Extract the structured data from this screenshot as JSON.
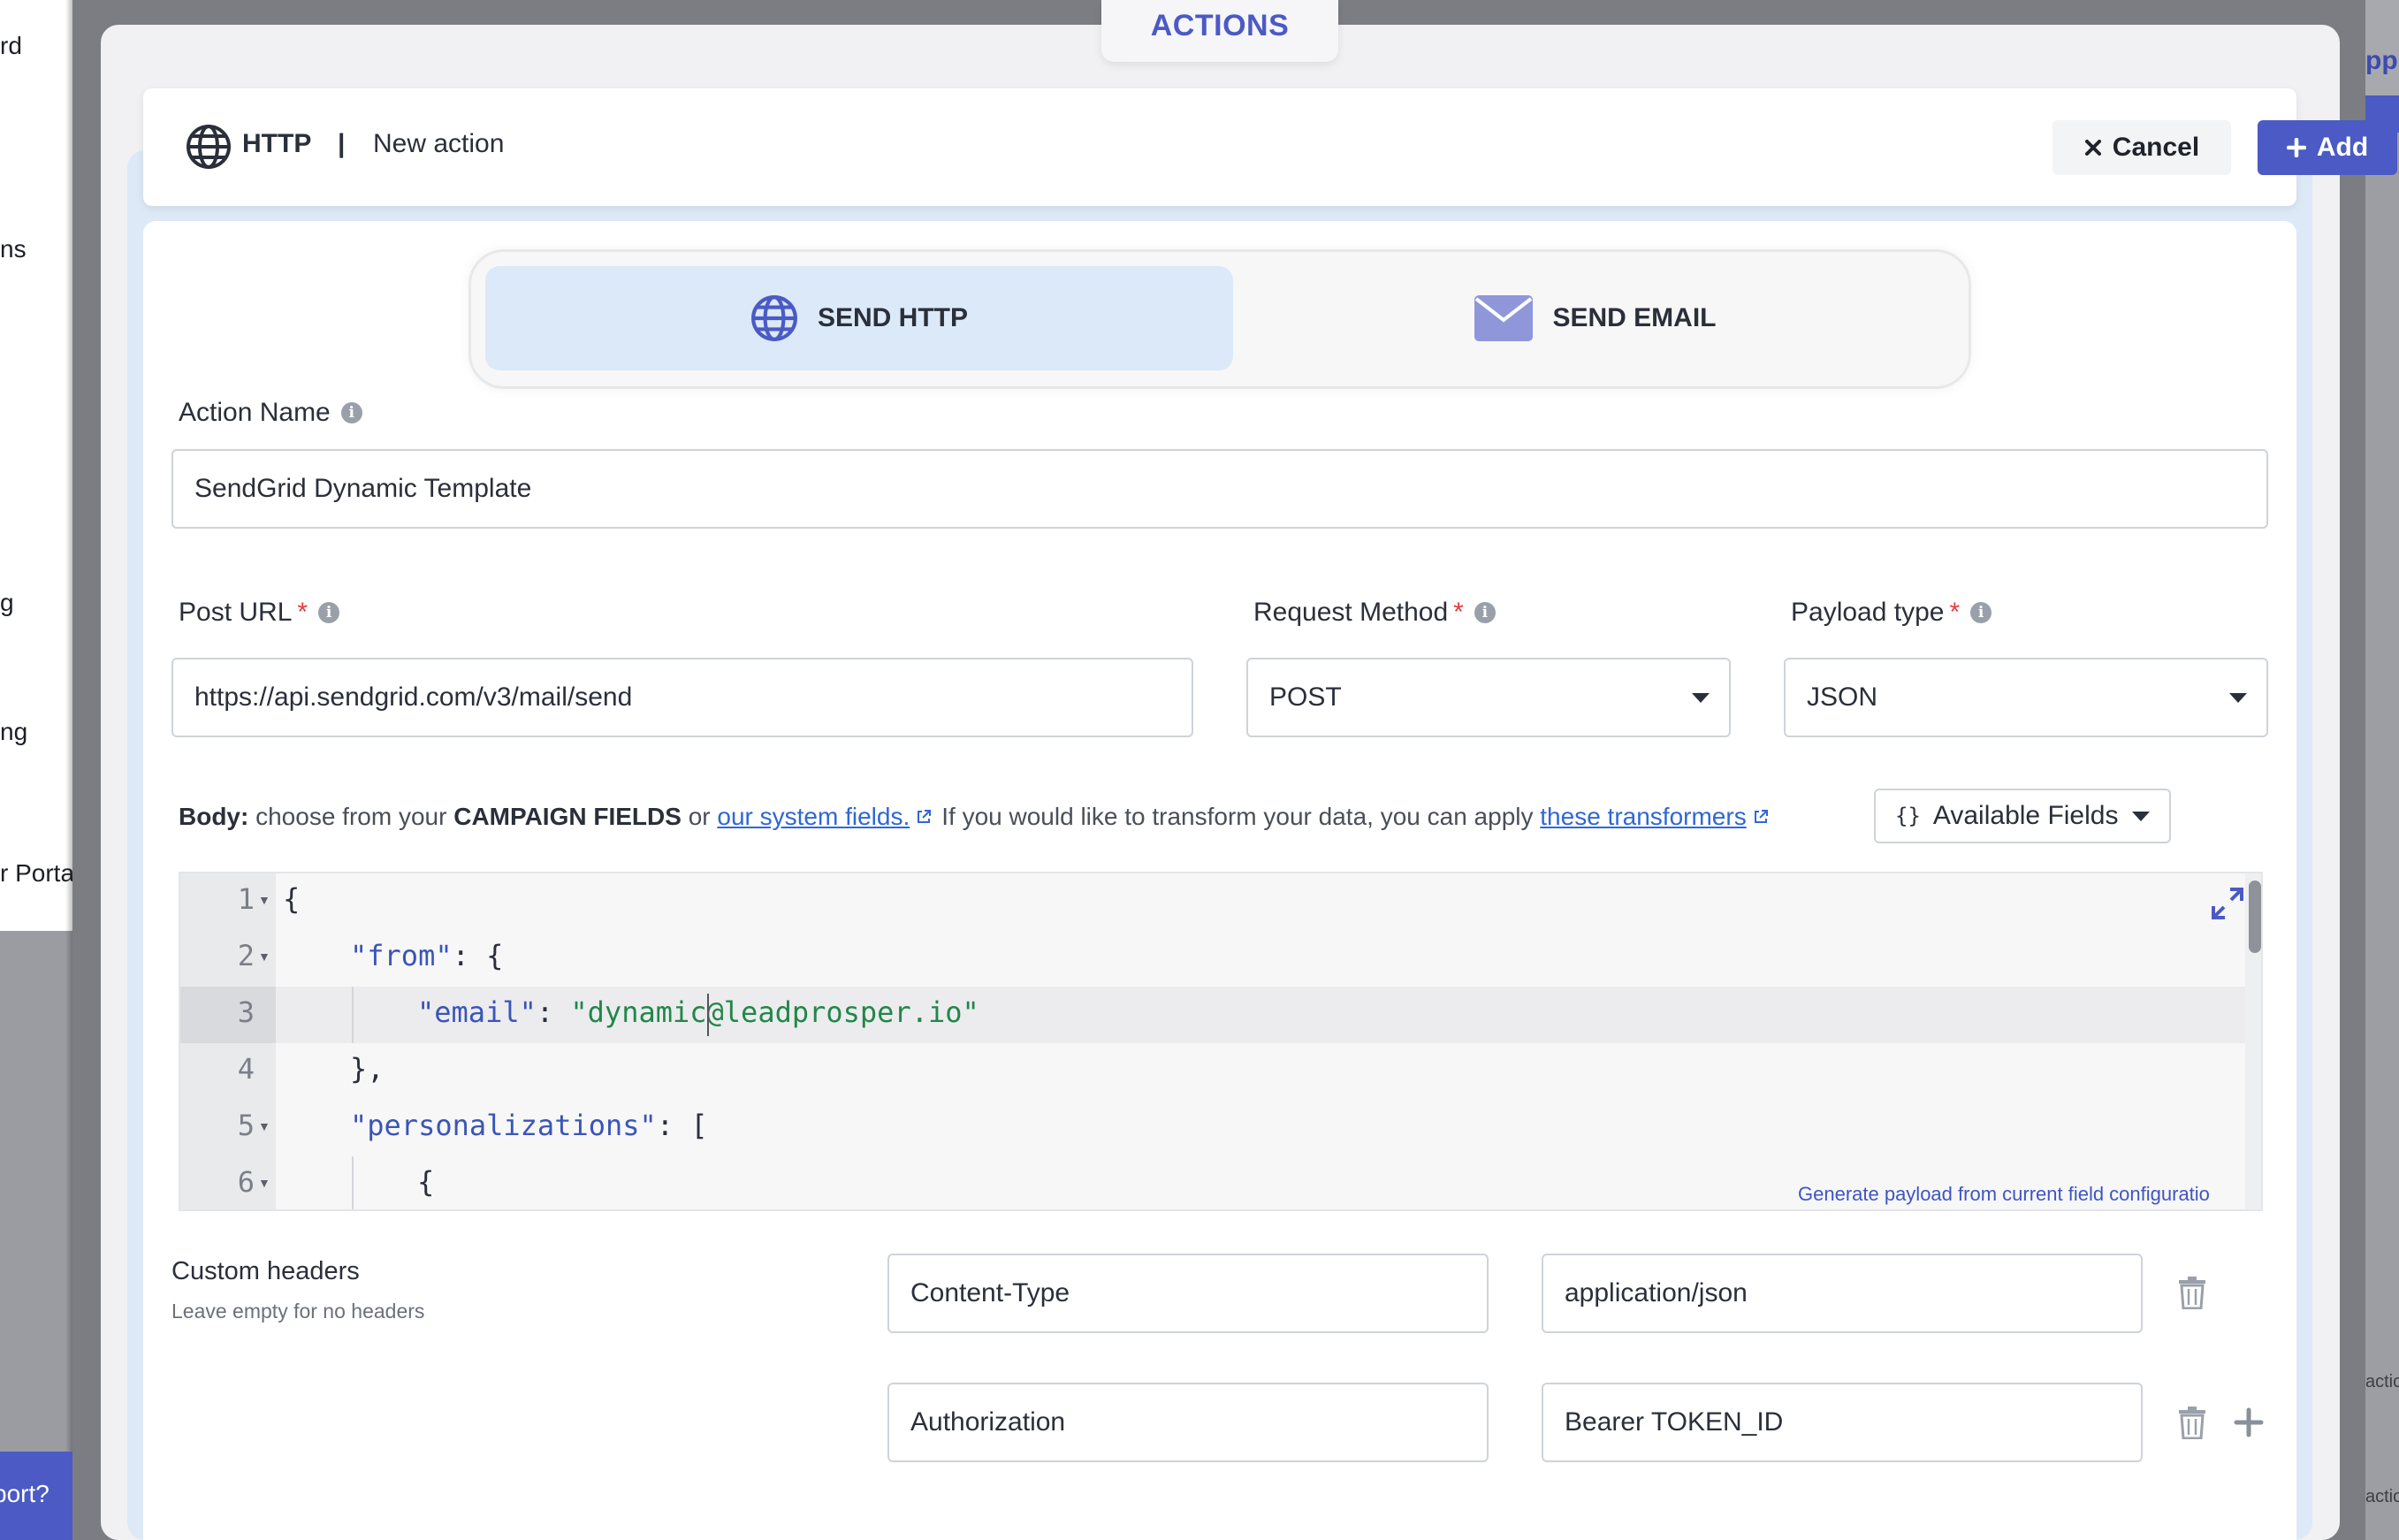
{
  "background": {
    "left_labels": [
      "rd",
      "ns",
      "g",
      "ng",
      "r Porta"
    ],
    "support_label": "port?",
    "right_labels": [
      "pp",
      "actio",
      "actio"
    ]
  },
  "modal": {
    "section_title": "ACTIONS",
    "header": {
      "icon": "globe-icon",
      "type_label": "HTTP",
      "separator": "|",
      "title": "New action",
      "cancel_label": "Cancel",
      "add_label": "Add"
    },
    "tabs": [
      {
        "icon": "globe-icon",
        "label": "SEND HTTP",
        "active": true
      },
      {
        "icon": "envelope-icon",
        "label": "SEND EMAIL",
        "active": false
      }
    ],
    "action_name": {
      "label": "Action Name",
      "value": "SendGrid Dynamic Template"
    },
    "post_url": {
      "label": "Post URL",
      "required_mark": "*",
      "value": "https://api.sendgrid.com/v3/mail/send"
    },
    "request_method": {
      "label": "Request Method",
      "required_mark": "*",
      "value": "POST"
    },
    "payload_type": {
      "label": "Payload type",
      "required_mark": "*",
      "value": "JSON"
    },
    "body": {
      "prefix": "Body:",
      "text1": "choose from your",
      "campaign_fields": "CAMPAIGN FIELDS",
      "text2": "or",
      "system_fields_link": "our system fields.",
      "text3": "If you would like to transform your data, you can apply",
      "transformers_link": "these transformers",
      "available_fields_label": "Available Fields",
      "available_fields_icon": "{}"
    },
    "editor": {
      "line_numbers": [
        "1",
        "2",
        "3",
        "4",
        "5",
        "6"
      ],
      "lines": [
        {
          "text": "{"
        },
        {
          "key": "\"from\"",
          "rest": ": {"
        },
        {
          "key": "\"email\"",
          "sep": ": ",
          "value": "\"dynamic@leadprosper.io\""
        },
        {
          "text": "},"
        },
        {
          "key": "\"personalizations\"",
          "rest": ": ["
        },
        {
          "text": "{"
        }
      ],
      "generate_link": "Generate payload from current field configuratio"
    },
    "custom_headers": {
      "label": "Custom headers",
      "hint": "Leave empty for no headers",
      "rows": [
        {
          "name": "Content-Type",
          "value": "application/json"
        },
        {
          "name": "Authorization",
          "value": "Bearer TOKEN_ID"
        }
      ]
    }
  }
}
